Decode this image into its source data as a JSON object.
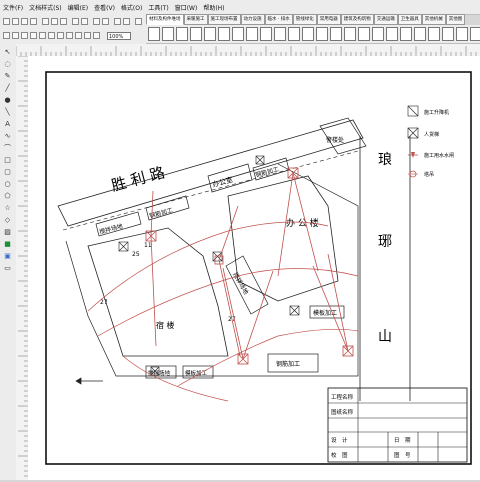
{
  "menu": [
    "文件(F)",
    "文档样式(S)",
    "编辑(E)",
    "查看(V)",
    "格式(O)",
    "工具(T)",
    "窗口(W)",
    "帮助(H)"
  ],
  "tabs": [
    "材料及构件堆场",
    "采暖施工",
    "施工现场布置",
    "动力设施",
    "临水 · 排水",
    "管线绿化",
    "常用电器",
    "建筑及构筑物",
    "交通运输",
    "卫生器具",
    "其他机械",
    "其他图"
  ],
  "zoom": "100%",
  "drawing": {
    "street_main": "胜 利 路",
    "street_side": [
      "琅",
      "琊",
      "山"
    ],
    "buildings": {
      "office_small": "办公室",
      "office_building": "办 公 楼",
      "dorm": "宿 楼",
      "guard": "警楼处"
    },
    "yards": {
      "mix_top": "搅拌场地",
      "rebar_top": "钢筋加工",
      "rebar_top2": "钢筋加工",
      "mix_mid": "搅拌场地",
      "rebar_right": "模板加工",
      "rebar_bottom": "钢筋加工",
      "mix_bottom": "搅拌场地",
      "form_bottom": "模板加工"
    },
    "numbers": {
      "n25": "25",
      "n11": "11",
      "n27a": "27",
      "n27b": "27"
    }
  },
  "legend": [
    {
      "label": "施工升降机"
    },
    {
      "label": "人货梯"
    },
    {
      "label": "施工用水水闸"
    },
    {
      "label": "塔吊"
    }
  ],
  "title_block": {
    "project_label": "工程名称",
    "drawing_label": "图纸名称",
    "design_label": "设　计",
    "date_label": "日　期",
    "check_label": "校　图",
    "number_label": "图　号"
  }
}
